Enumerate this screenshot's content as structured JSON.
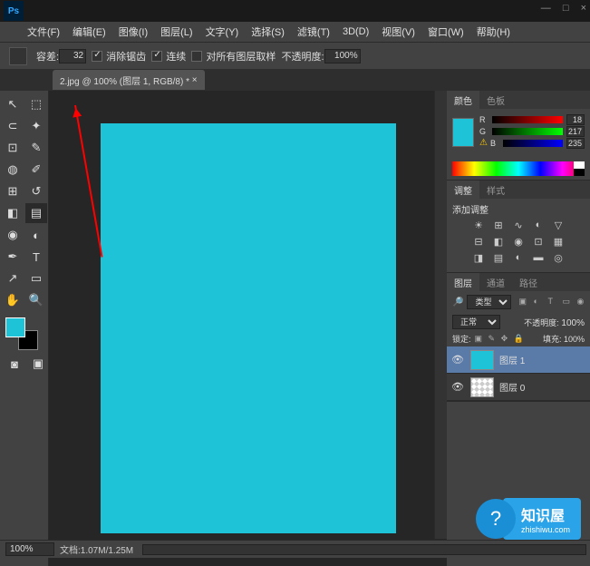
{
  "app": {
    "logo": "Ps"
  },
  "menu": {
    "file": "文件(F)",
    "edit": "编辑(E)",
    "image": "图像(I)",
    "layer": "图层(L)",
    "type": "文字(Y)",
    "select": "选择(S)",
    "filter": "滤镜(T)",
    "threed": "3D(D)",
    "view": "视图(V)",
    "window": "窗口(W)",
    "help": "帮助(H)"
  },
  "winctrl": {
    "min": "—",
    "max": "□",
    "close": "×"
  },
  "options": {
    "tolerance_label": "容差:",
    "tolerance": "32",
    "antialias": "消除锯齿",
    "contiguous": "连续",
    "sample_all": "对所有图层取样",
    "opacity_label": "不透明度:",
    "opacity": "100%"
  },
  "document": {
    "tab": "2.jpg @ 100% (图层 1, RGB/8) *",
    "tab_close": "×"
  },
  "tools": {
    "move": "↖",
    "marquee": "⬚",
    "lasso": "⊂",
    "wand": "✦",
    "crop": "⊡",
    "eyedrop": "✎",
    "heal": "◍",
    "brush": "✐",
    "stamp": "⊞",
    "history": "↺",
    "eraser": "◧",
    "gradient": "▤",
    "blur": "◉",
    "dodge": "◐",
    "pen": "✒",
    "type": "T",
    "path": "↗",
    "shape": "▭",
    "hand": "✋",
    "zoom": "🔍",
    "mask": "◙",
    "screen": "▣"
  },
  "colors": {
    "fg": "#1fc3d8",
    "bg": "#000000",
    "r": "18",
    "g": "217",
    "b": "235"
  },
  "panels": {
    "color_tab": "颜色",
    "swatches_tab": "色板",
    "adjustments_tab": "调整",
    "styles_tab": "样式",
    "adjustments_label": "添加调整",
    "layers_tab": "图层",
    "channels_tab": "通道",
    "paths_tab": "路径",
    "kind_label": "类型",
    "blend_mode": "正常",
    "opacity_label": "不透明度:",
    "opacity_val": "100%",
    "lock_label": "锁定:",
    "fill_label": "填充:",
    "fill_val": "100%",
    "layer1": "图层 1",
    "layer0": "图层 0"
  },
  "status": {
    "zoom": "100%",
    "doc_info": "文档:1.07M/1.25M"
  },
  "watermark": {
    "main": "知识屋",
    "sub": "zhishiwu.com",
    "icon": "?"
  }
}
